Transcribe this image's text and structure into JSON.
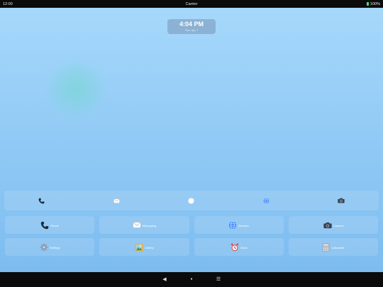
{
  "status_bar": {
    "time": "12:00",
    "carrier": "Carrier",
    "battery": "100%"
  },
  "clock_widget": {
    "time": "4:04 PM",
    "date": "Tue, Apr 7"
  },
  "dock": {
    "items": [
      {
        "name": "phone",
        "icon": "phone-icon"
      },
      {
        "name": "messaging",
        "icon": "envelope-icon"
      },
      {
        "name": "home",
        "icon": "circle-icon"
      },
      {
        "name": "browser",
        "icon": "globe-icon"
      },
      {
        "name": "camera",
        "icon": "camera-icon"
      }
    ]
  },
  "apps": [
    {
      "label": "Phone",
      "icon": "phone-icon"
    },
    {
      "label": "Messaging",
      "icon": "envelope-icon"
    },
    {
      "label": "Browser",
      "icon": "globe-icon"
    },
    {
      "label": "Camera",
      "icon": "camera-icon"
    },
    {
      "label": "Settings",
      "icon": "gear-icon"
    },
    {
      "label": "Gallery",
      "icon": "picture-icon"
    },
    {
      "label": "Clock",
      "icon": "alarm-clock-icon"
    },
    {
      "label": "Calculator",
      "icon": "calculator-icon"
    }
  ],
  "nav_bar": {
    "back": "◀",
    "home": "●",
    "recents": "☰"
  },
  "colors": {
    "wallpaper_top": "#a6d8fb",
    "wallpaper_bottom": "#7dbcf0",
    "bar_background": "#0b0b0b",
    "battery": "#4ade80"
  }
}
